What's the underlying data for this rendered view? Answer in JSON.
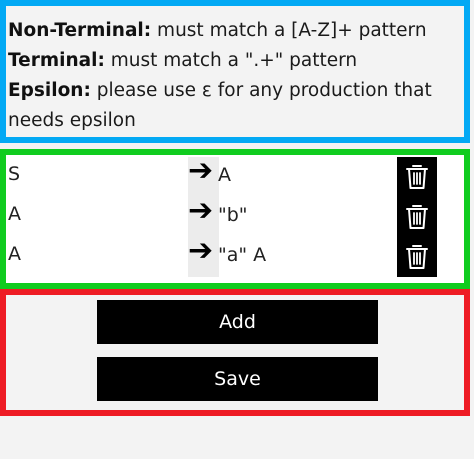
{
  "info": {
    "nonterminal_label": "Non-Terminal:",
    "nonterminal_text": " must match a [A-Z]+ pattern",
    "terminal_label": "Terminal:",
    "terminal_text": " must match a \".+\" pattern",
    "epsilon_label": "Epsilon:",
    "epsilon_text_line1": " please use ε for any production that",
    "epsilon_text_line2": "needs epsilon"
  },
  "productions": [
    {
      "lhs": "S",
      "arrow": "➔",
      "rhs": "A",
      "delete_icon": "trash-icon"
    },
    {
      "lhs": "A",
      "arrow": "➔",
      "rhs": "\"b\"",
      "delete_icon": "trash-icon"
    },
    {
      "lhs": "A",
      "arrow": "➔",
      "rhs": "\"a\" A",
      "delete_icon": "trash-icon"
    }
  ],
  "actions": {
    "add_label": "Add",
    "save_label": "Save"
  },
  "colors": {
    "info_border": "#03a9f4",
    "productions_border": "#10cc1f",
    "actions_border": "#ee1c24",
    "button_bg": "#000000"
  }
}
